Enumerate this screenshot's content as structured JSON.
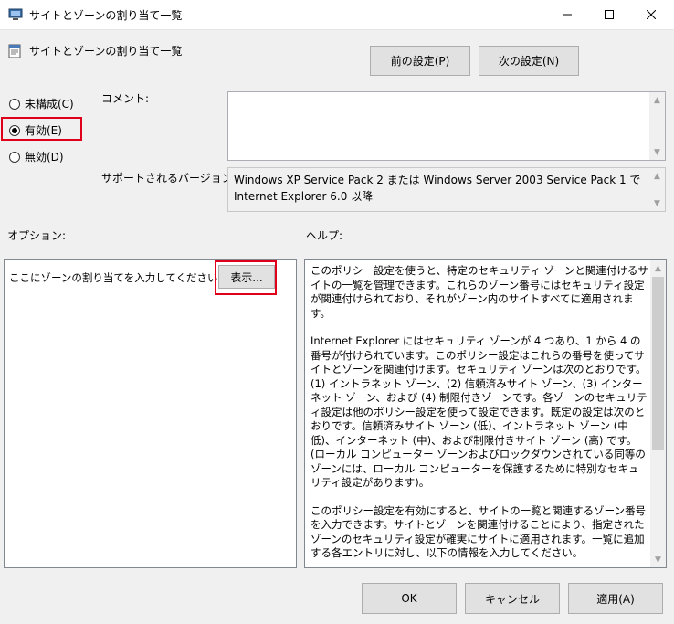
{
  "window": {
    "title": "サイトとゾーンの割り当て一覧",
    "minimize_icon": "minimize-icon",
    "maximize_icon": "maximize-icon",
    "close_icon": "close-icon"
  },
  "header": {
    "title": "サイトとゾーンの割り当て一覧",
    "prev_button": "前の設定(P)",
    "next_button": "次の設定(N)"
  },
  "state": {
    "options": [
      {
        "label": "未構成(C)",
        "checked": false
      },
      {
        "label": "有効(E)",
        "checked": true
      },
      {
        "label": "無効(D)",
        "checked": false
      }
    ]
  },
  "comment": {
    "label": "コメント:",
    "value": ""
  },
  "supported": {
    "label": "サポートされるバージョン:",
    "value": "Windows XP Service Pack 2 または Windows Server 2003 Service Pack 1 で Internet Explorer 6.0 以降"
  },
  "options_section": {
    "label": "オプション:",
    "prompt": "ここにゾーンの割り当てを入力してください。",
    "show_button": "表示..."
  },
  "help_section": {
    "label": "ヘルプ:",
    "paragraphs": [
      "このポリシー設定を使うと、特定のセキュリティ ゾーンと関連付けるサイトの一覧を管理できます。これらのゾーン番号にはセキュリティ設定が関連付けられており、それがゾーン内のサイトすべてに適用されます。",
      "Internet Explorer にはセキュリティ ゾーンが 4 つあり、1 から 4 の番号が付けられています。このポリシー設定はこれらの番号を使ってサイトとゾーンを関連付けます。セキュリティ ゾーンは次のとおりです。(1) イントラネット ゾーン、(2) 信頼済みサイト ゾーン、(3) インターネット ゾーン、および (4) 制限付きゾーンです。各ゾーンのセキュリティ設定は他のポリシー設定を使って設定できます。既定の設定は次のとおりです。信頼済みサイト ゾーン (低)、イントラネット ゾーン (中低)、インターネット (中)、および制限付きサイト ゾーン (高) です。(ローカル コンピューター ゾーンおよびロックダウンされている同等のゾーンには、ローカル コンピューターを保護するために特別なセキュリティ設定があります)。",
      "このポリシー設定を有効にすると、サイトの一覧と関連するゾーン番号を入力できます。サイトとゾーンを関連付けることにより、指定されたゾーンのセキュリティ設定が確実にサイトに適用されます。一覧に追加する各エントリに対し、以下の情報を入力してください。"
    ]
  },
  "footer": {
    "ok": "OK",
    "cancel": "キャンセル",
    "apply": "適用(A)"
  },
  "colors": {
    "highlight": "#e0001b",
    "background": "#f0f0f0"
  }
}
